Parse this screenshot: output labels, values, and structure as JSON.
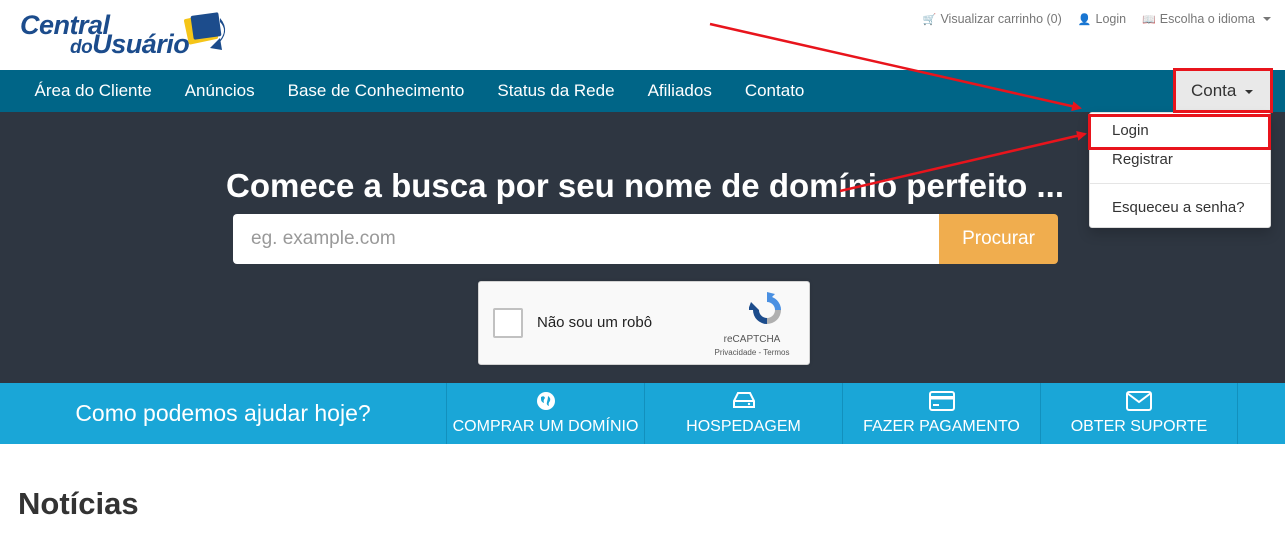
{
  "header": {
    "logo": {
      "line1": "Central",
      "line2_small": "do",
      "line2": "Usuário"
    },
    "toplinks": [
      {
        "icon": "cart-icon",
        "label": "Visualizar carrinho (0)"
      },
      {
        "icon": "user-icon",
        "label": "Login"
      },
      {
        "icon": "language-icon",
        "label": "Escolha o idioma"
      }
    ]
  },
  "nav": {
    "items": [
      "Área do Cliente",
      "Anúncios",
      "Base de Conhecimento",
      "Status da Rede",
      "Afiliados",
      "Contato"
    ],
    "account_label": "Conta"
  },
  "dropdown": {
    "items": [
      "Login",
      "Registrar",
      "Esqueceu a senha?"
    ]
  },
  "hero": {
    "title": "Comece a busca por seu nome de domínio perfeito ...",
    "search_placeholder": "eg. example.com",
    "search_button": "Procurar",
    "captcha": {
      "label": "Não sou um robô",
      "brand": "reCAPTCHA",
      "terms": "Privacidade - Termos"
    }
  },
  "helpbar": {
    "question": "Como podemos ajudar hoje?",
    "items": [
      {
        "icon": "globe-icon",
        "label": "COMPRAR UM DOMÍNIO"
      },
      {
        "icon": "hard-drive-icon",
        "label": "HOSPEDAGEM"
      },
      {
        "icon": "credit-card-icon",
        "label": "FAZER PAGAMENTO"
      },
      {
        "icon": "envelope-icon",
        "label": "OBTER SUPORTE"
      }
    ]
  },
  "news": {
    "heading": "Notícias"
  },
  "colors": {
    "navbar": "#006587",
    "hero": "#2e3641",
    "helpbar": "#1aa6d7",
    "search_button": "#f0ad4e",
    "annotation": "#e8141c",
    "logo_text": "#1c4c8c"
  }
}
